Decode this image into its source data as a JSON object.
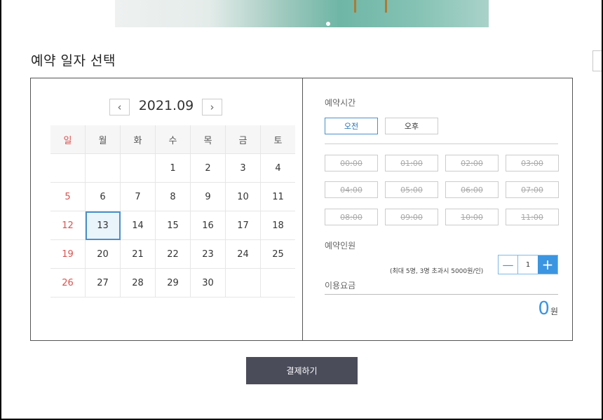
{
  "banner": {
    "image_name": "room-photo"
  },
  "section": {
    "title": "예약 일자 선택"
  },
  "calendar": {
    "month_label": "2021.09",
    "prev_icon": "chevron-left-icon",
    "next_icon": "chevron-right-icon",
    "weekdays": [
      "일",
      "월",
      "화",
      "수",
      "목",
      "금",
      "토"
    ],
    "weeks": [
      [
        "",
        "",
        "",
        "1",
        "2",
        "3",
        "4"
      ],
      [
        "5",
        "6",
        "7",
        "8",
        "9",
        "10",
        "11"
      ],
      [
        "12",
        "13",
        "14",
        "15",
        "16",
        "17",
        "18"
      ],
      [
        "19",
        "20",
        "21",
        "22",
        "23",
        "24",
        "25"
      ],
      [
        "26",
        "27",
        "28",
        "29",
        "30",
        "",
        ""
      ]
    ],
    "selected_day": "13",
    "sunday_color": "#d9534f",
    "selected_border_color": "#4a90c8"
  },
  "booking": {
    "time_label": "예약시간",
    "am_label": "오전",
    "pm_label": "오후",
    "active_period": "오전",
    "time_slots": [
      "00:00",
      "01:00",
      "02:00",
      "03:00",
      "04:00",
      "05:00",
      "06:00",
      "07:00",
      "08:00",
      "09:00",
      "10:00",
      "11:00"
    ],
    "slots_disabled": true,
    "people_label": "예약인원",
    "people_note": "(최대 5명, 3명 초과시 5000원/인)",
    "quantity": "1",
    "minus_icon": "minus-icon",
    "plus_icon": "plus-icon",
    "fee_label": "이용요금",
    "price_amount": "0",
    "price_unit": "원",
    "accent_color": "#3b95e0"
  },
  "actions": {
    "pay_label": "결제하기",
    "pay_color": "#4a4c5a"
  }
}
